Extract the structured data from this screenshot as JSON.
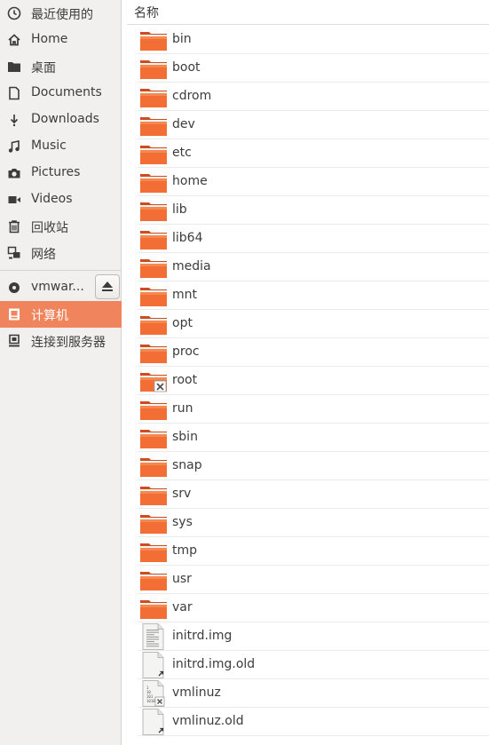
{
  "sidebar": {
    "items": [
      {
        "label": "最近使用的",
        "icon": "clock-icon"
      },
      {
        "label": "Home",
        "icon": "home-icon"
      },
      {
        "label": "桌面",
        "icon": "folder-icon"
      },
      {
        "label": "Documents",
        "icon": "document-icon"
      },
      {
        "label": "Downloads",
        "icon": "download-icon"
      },
      {
        "label": "Music",
        "icon": "music-icon"
      },
      {
        "label": "Pictures",
        "icon": "camera-icon"
      },
      {
        "label": "Videos",
        "icon": "video-icon"
      },
      {
        "label": "回收站",
        "icon": "trash-icon"
      },
      {
        "label": "网络",
        "icon": "network-icon"
      }
    ],
    "devices": [
      {
        "label": "vmwar...",
        "icon": "disc-icon"
      },
      {
        "label": "计算机",
        "icon": "computer-icon",
        "active": true
      },
      {
        "label": "连接到服务器",
        "icon": "server-icon"
      }
    ],
    "accent_color": "#f0845c"
  },
  "list": {
    "column_header": "名称",
    "files": [
      {
        "name": "bin",
        "type": "folder"
      },
      {
        "name": "boot",
        "type": "folder"
      },
      {
        "name": "cdrom",
        "type": "folder"
      },
      {
        "name": "dev",
        "type": "folder"
      },
      {
        "name": "etc",
        "type": "folder"
      },
      {
        "name": "home",
        "type": "folder"
      },
      {
        "name": "lib",
        "type": "folder"
      },
      {
        "name": "lib64",
        "type": "folder"
      },
      {
        "name": "media",
        "type": "folder"
      },
      {
        "name": "mnt",
        "type": "folder"
      },
      {
        "name": "opt",
        "type": "folder"
      },
      {
        "name": "proc",
        "type": "folder"
      },
      {
        "name": "root",
        "type": "folder-locked"
      },
      {
        "name": "run",
        "type": "folder"
      },
      {
        "name": "sbin",
        "type": "folder"
      },
      {
        "name": "snap",
        "type": "folder"
      },
      {
        "name": "srv",
        "type": "folder"
      },
      {
        "name": "sys",
        "type": "folder"
      },
      {
        "name": "tmp",
        "type": "folder"
      },
      {
        "name": "usr",
        "type": "folder"
      },
      {
        "name": "var",
        "type": "folder"
      },
      {
        "name": "initrd.img",
        "type": "text-file"
      },
      {
        "name": "initrd.img.old",
        "type": "link-file"
      },
      {
        "name": "vmlinuz",
        "type": "binary-file-locked"
      },
      {
        "name": "vmlinuz.old",
        "type": "link-file"
      }
    ]
  }
}
